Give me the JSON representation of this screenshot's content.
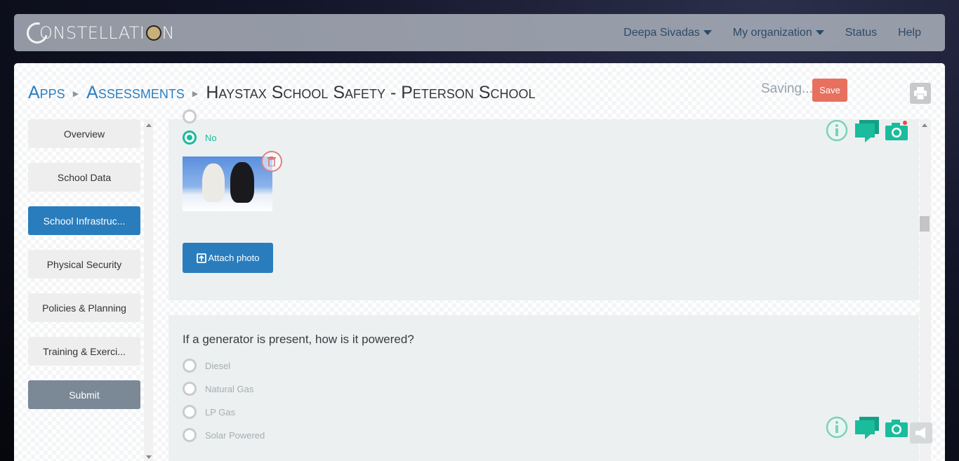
{
  "navbar": {
    "logo_text": "CONSTELLATION",
    "user": "Deepa Sivadas",
    "organization": "My organization",
    "status": "Status",
    "help": "Help"
  },
  "breadcrumb": {
    "apps": "Apps",
    "assessments": "Assessments",
    "current": "Haystax School Safety - Peterson School"
  },
  "header": {
    "saving_text": "Saving...",
    "save_label": "Save"
  },
  "sidebar": {
    "items": [
      {
        "label": "Overview"
      },
      {
        "label": "School Data"
      },
      {
        "label": "School Infrastruc..."
      },
      {
        "label": "Physical Security"
      },
      {
        "label": "Policies & Planning"
      },
      {
        "label": "Training & Exerci..."
      }
    ],
    "submit_label": "Submit"
  },
  "question1": {
    "selected_option": "No",
    "attach_label": "Attach photo"
  },
  "question2": {
    "text": "If a generator is present, how is it powered?",
    "options": [
      "Diesel",
      "Natural Gas",
      "LP Gas",
      "Solar Powered"
    ]
  },
  "colors": {
    "accent": "#2a7dbd",
    "success": "#1abc9c",
    "danger": "#e8705f"
  }
}
